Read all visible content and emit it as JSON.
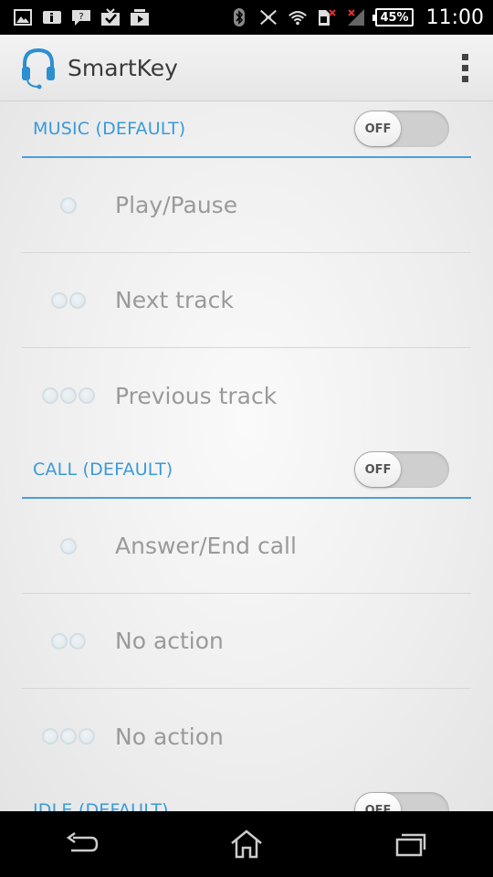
{
  "status_bar": {
    "left_icons": [
      "gallery-icon",
      "info-icon",
      "chat-icon",
      "download-check-icon",
      "video-store-icon"
    ],
    "right_icons": [
      "bluetooth-icon",
      "nfc-icon",
      "wifi-icon",
      "no-sim-icon",
      "signal-icon"
    ],
    "battery": "45%",
    "time": "11:00"
  },
  "action_bar": {
    "title": "SmartKey",
    "logo_icon": "headset-icon",
    "menu_icon": "overflow-menu-icon"
  },
  "sections": [
    {
      "title": "MUSIC (DEFAULT)",
      "toggle": "OFF",
      "rows": [
        {
          "presses": 1,
          "label": "Play/Pause"
        },
        {
          "presses": 2,
          "label": "Next track"
        },
        {
          "presses": 3,
          "label": "Previous track"
        }
      ]
    },
    {
      "title": "CALL (DEFAULT)",
      "toggle": "OFF",
      "rows": [
        {
          "presses": 1,
          "label": "Answer/End call"
        },
        {
          "presses": 2,
          "label": "No action"
        },
        {
          "presses": 3,
          "label": "No action"
        }
      ]
    },
    {
      "title": "IDLE (DEFAULT)",
      "toggle": "OFF",
      "rows": []
    }
  ],
  "nav_bar": {
    "icons": [
      "back-icon",
      "home-icon",
      "recent-apps-icon"
    ]
  },
  "colors": {
    "accent": "#3b9ad8",
    "divider_accent": "#4aa0d8",
    "row_text": "#9a9a9a"
  }
}
